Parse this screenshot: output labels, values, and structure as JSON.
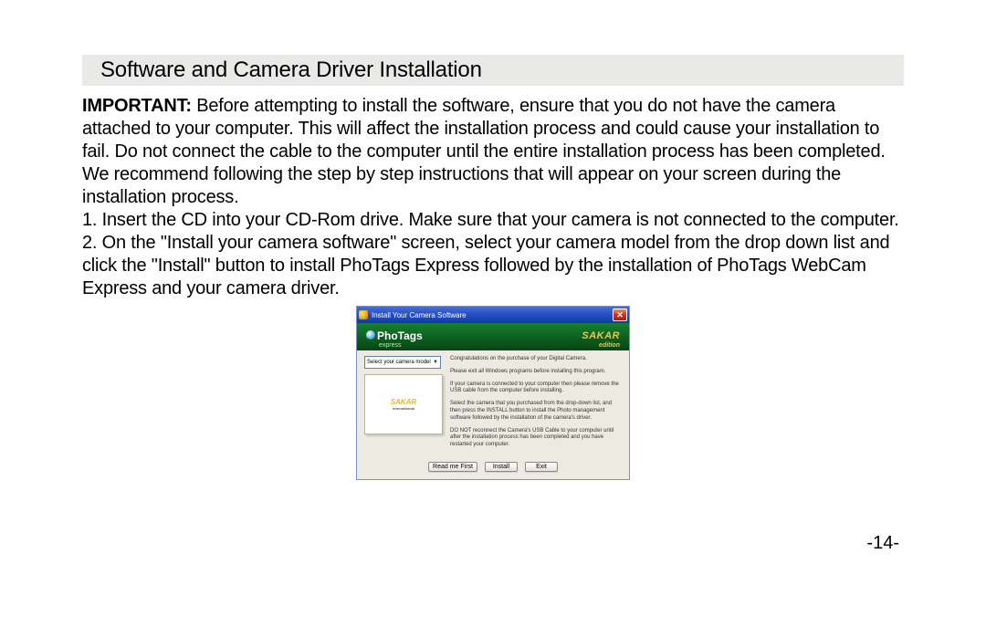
{
  "section": {
    "heading": "Software and Camera Driver Installation",
    "important_label": "IMPORTANT:",
    "important_body": " Before attempting to install the software, ensure that you do not have the camera attached to your computer. This will affect the installation process and could cause your installation to fail. Do not connect the cable to the computer until the entire installation process has been completed. We recommend following the step by step instructions that will appear on your screen during the installation process.",
    "step1": "1. Insert the CD into your CD-Rom drive. Make sure that your camera is not connected to the computer.",
    "step2": "2.  On the \"Install your camera software\" screen, select your camera model from the drop down list and click the \"Install\" button to install PhoTags Express followed by the installation of PhoTags WebCam Express and your camera driver."
  },
  "installer": {
    "title": "Install Your Camera Software",
    "brand": {
      "name": "PhoTags",
      "subline": "express",
      "edition_brand": "SAKAR",
      "edition_label": "edition"
    },
    "model_select_label": "Select your camera model",
    "preview_badge": "SAKAR",
    "preview_sub": "international",
    "instructions": [
      "Congratulations on the purchase of your Digital Camera.",
      "Please exit all Windows programs before installing this program.",
      "If your camera is connected to your computer then please remove the USB cable from the computer before installing.",
      "Select the camera that you purchased from the drop-down list, and then press the INSTALL button to install the Photo management software followed by the installation of the camera's driver.",
      "DO NOT reconnect the Camera's USB Cable to your computer until after the installation process has been completed and you have restarted your computer."
    ],
    "buttons": {
      "readme": "Read me First",
      "install": "Install",
      "exit": "Exit"
    }
  },
  "page_number": "-14-"
}
